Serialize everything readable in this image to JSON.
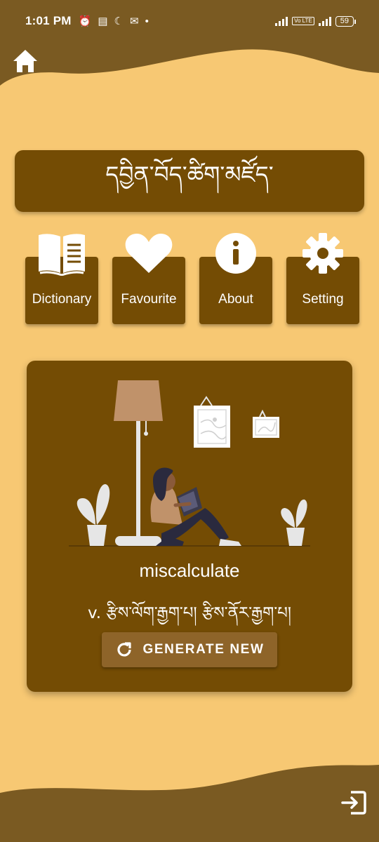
{
  "status_bar": {
    "time": "1:01 PM",
    "notification_icons": [
      "alarm-icon",
      "news-icon",
      "moon-icon",
      "gmail-icon",
      "dot-icon"
    ],
    "volte_label": "Vo LTE",
    "battery": "59"
  },
  "nav": {
    "home_icon": "home-icon",
    "exit_icon": "exit-icon"
  },
  "header": {
    "title": "དབྱིན་བོད་ཚིག་མཛོད་"
  },
  "menu": [
    {
      "label": "Dictionary",
      "icon": "book-icon"
    },
    {
      "label": "Favourite",
      "icon": "heart-icon"
    },
    {
      "label": "About",
      "icon": "info-icon"
    },
    {
      "label": "Setting",
      "icon": "gear-icon"
    }
  ],
  "word_of_day": {
    "word": "miscalculate",
    "meaning": "v. རྩིས་ལོག་རྒྱག་པ། རྩིས་ནོར་རྒྱག་པ།",
    "button_label": "GENERATE NEW",
    "button_icon": "refresh-icon"
  },
  "colors": {
    "background": "#f7c873",
    "card": "#744c04",
    "wave": "#7a5a22",
    "button": "#8e6429"
  }
}
